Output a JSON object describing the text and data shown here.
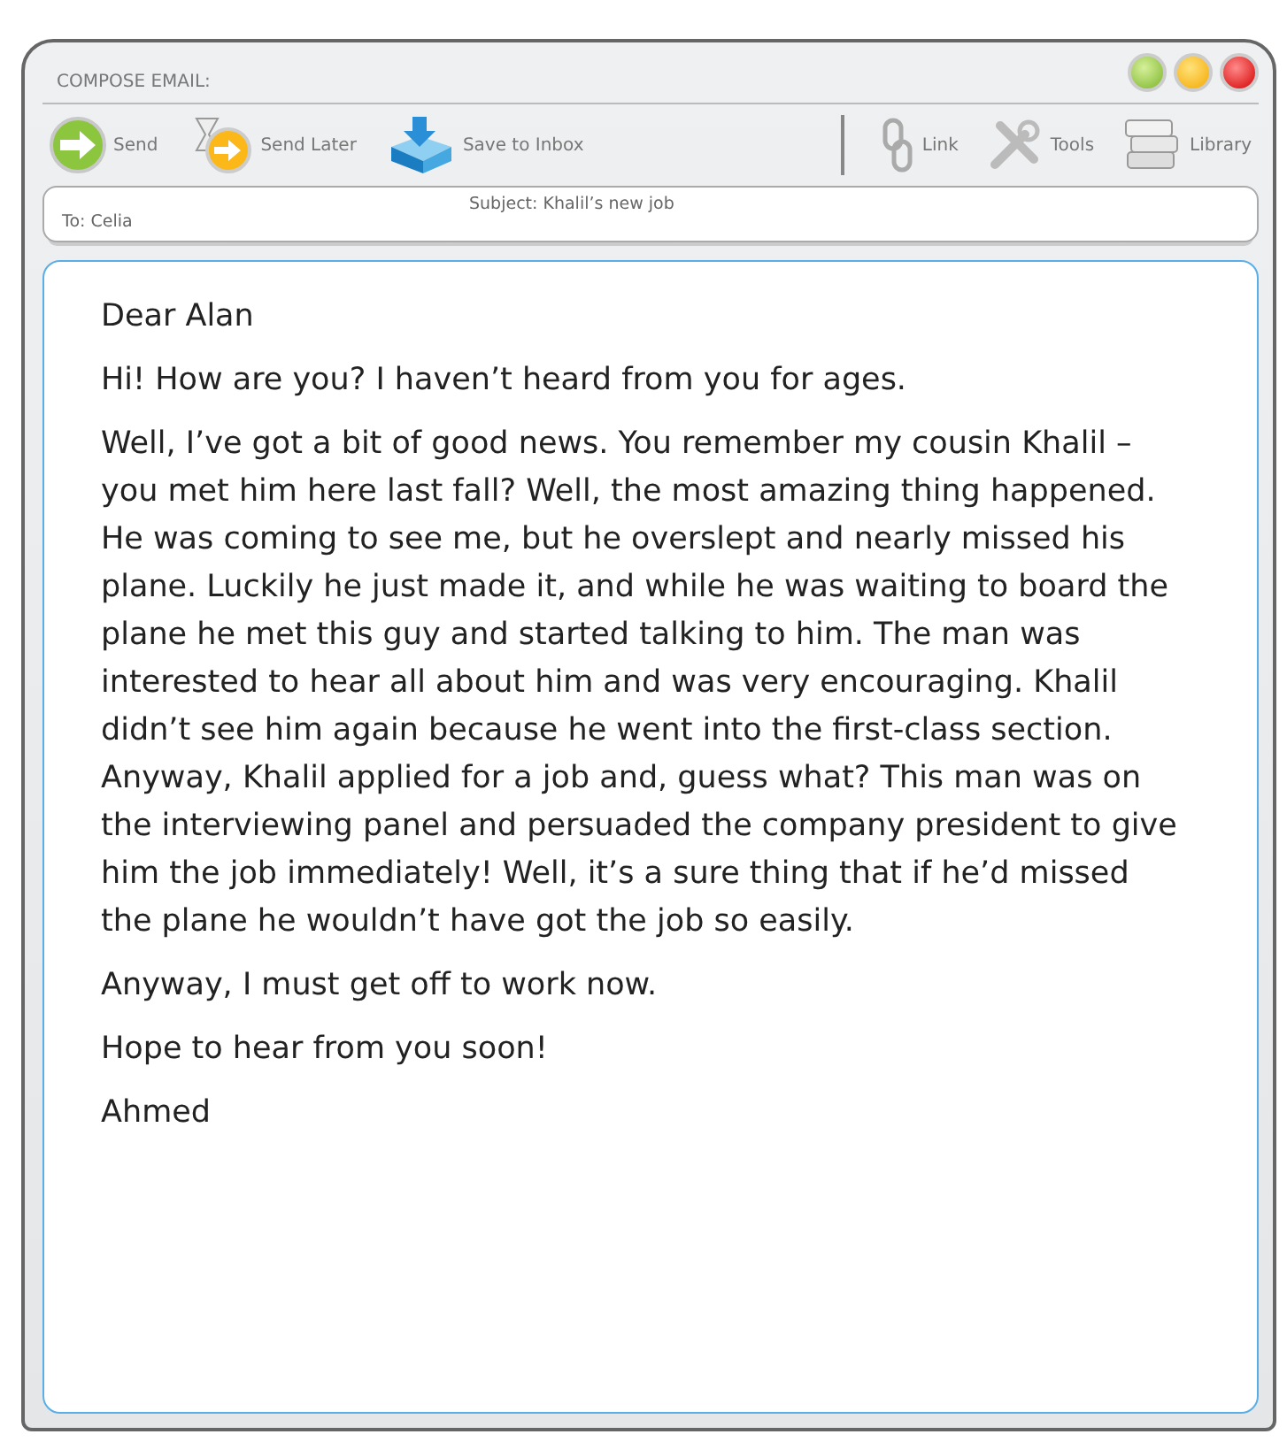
{
  "window": {
    "title": "COMPOSE EMAIL:"
  },
  "toolbar": {
    "left": [
      {
        "kind": "send",
        "label": "Send"
      },
      {
        "kind": "later",
        "label": "Send Later"
      },
      {
        "kind": "save",
        "label": "Save to Inbox"
      }
    ],
    "right": [
      {
        "kind": "link",
        "label": "Link"
      },
      {
        "kind": "tools",
        "label": "Tools"
      },
      {
        "kind": "library",
        "label": "Library"
      }
    ]
  },
  "header": {
    "to_label": "To:",
    "to": "Celia",
    "subject_label": "Subject:",
    "subject": "Khalil’s new job"
  },
  "body": [
    "Dear Alan",
    "Hi! How are you? I haven’t heard from you for ages.",
    "Well, I’ve got a bit of good news. You remember my cousin Khalil – you met him here last fall? Well, the most amazing thing happened. He was coming to see me, but he overslept and nearly missed his plane. Luckily he just made it, and while he was waiting to board the plane he met this guy and started talking to him. The man was interested to hear all about him and was very encouraging. Khalil didn’t see him again because he went into the first-class section. Anyway, Khalil applied for a job and, guess what? This man was on the interviewing panel and persuaded the company president to give him the job immediately! Well, it’s a sure thing that if he’d missed the plane he wouldn’t have got the job so easily.",
    "Anyway, I must get off to work now.",
    "Hope to hear from you soon!",
    "Ahmed"
  ]
}
